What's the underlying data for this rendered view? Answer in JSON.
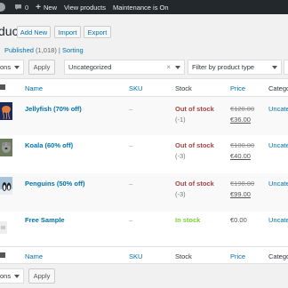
{
  "adminbar": {
    "comments_count": "0",
    "new_label": "New",
    "view_products_label": "View products",
    "maintenance_label": "Maintenance is On"
  },
  "page": {
    "title": "ducts",
    "add_new": "Add New",
    "import": "Import",
    "export": "Export"
  },
  "views": {
    "published": "Published",
    "published_count": "(1,018)",
    "separator": "|",
    "sorting": "Sorting"
  },
  "filters": {
    "bulk_actions_top": "ons",
    "apply_top": "Apply",
    "category_value": "Uncategorized",
    "clear_symbol": "×",
    "product_type_value": "Filter by product type",
    "third_filter_value": "F",
    "bulk_actions_bottom": "ons",
    "apply_bottom": "Apply"
  },
  "columns": {
    "name": "Name",
    "sku": "SKU",
    "stock": "Stock",
    "price": "Price",
    "categories": "Catego"
  },
  "products": [
    {
      "name": "Jellyfish (70% off)",
      "sku": "–",
      "stock": "Out of stock",
      "qty": "(-1)",
      "old_price": "€120.00",
      "price": "€36.00",
      "category": "Uncate"
    },
    {
      "name": "Koala (60% off)",
      "sku": "–",
      "stock": "Out of stock",
      "qty": "(-3)",
      "old_price": "€100.00",
      "price": "€40.00",
      "category": "Uncate"
    },
    {
      "name": "Penguins (50% off)",
      "sku": "–",
      "stock": "Out of stock",
      "qty": "(-3)",
      "old_price": "€198.00",
      "price": "€99.00",
      "category": "Uncate"
    },
    {
      "name": "Free Sample",
      "sku": "–",
      "stock": "In stock",
      "qty": "",
      "old_price": "",
      "price": "€0.00",
      "category": "Uncate"
    }
  ],
  "colors": {
    "adminbar_bg": "#23282d",
    "link": "#0073aa",
    "out_of_stock": "#a44444",
    "in_stock": "#7ad03a"
  },
  "icons": [
    "wordpress-icon",
    "comment-icon",
    "plus-icon"
  ]
}
